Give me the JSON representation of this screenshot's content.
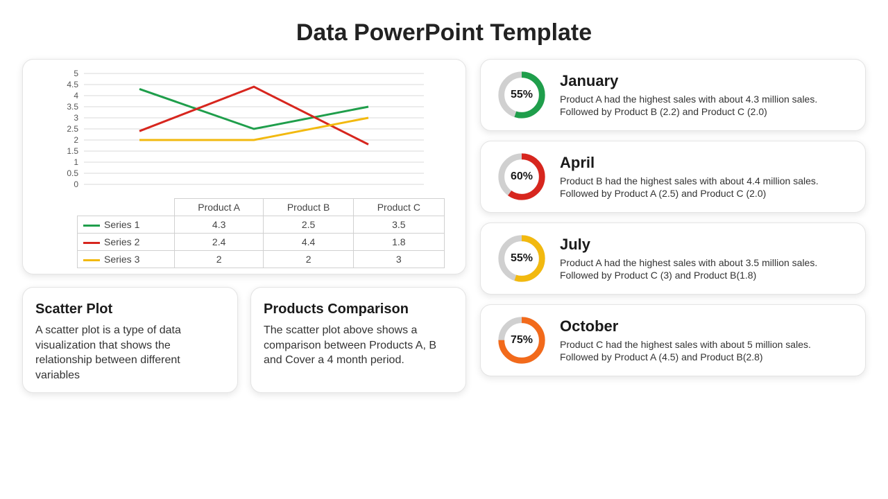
{
  "title": "Data PowerPoint Template",
  "colors": {
    "series1": "#1F9E4B",
    "series2": "#D7261E",
    "series3": "#F2B90F",
    "orange": "#F26A1B"
  },
  "chart_data": {
    "type": "line",
    "categories": [
      "Product A",
      "Product B",
      "Product C"
    ],
    "series": [
      {
        "name": "Series 1",
        "values": [
          4.3,
          2.5,
          3.5
        ],
        "color": "#1F9E4B"
      },
      {
        "name": "Series 2",
        "values": [
          2.4,
          4.4,
          1.8
        ],
        "color": "#D7261E"
      },
      {
        "name": "Series 3",
        "values": [
          2,
          2,
          3
        ],
        "color": "#F2B90F"
      }
    ],
    "ylim": [
      0,
      5
    ],
    "ystep": 0.5,
    "title": "",
    "xlabel": "",
    "ylabel": ""
  },
  "info": {
    "scatter": {
      "title": "Scatter Plot",
      "body": "A scatter plot is a type of data visualization that shows the relationship between different variables"
    },
    "comparison": {
      "title": "Products Comparison",
      "body": "The scatter plot above shows a comparison between Products A, B and Cover a 4 month period."
    }
  },
  "months": [
    {
      "title": "January",
      "pct": 55,
      "pct_label": "55%",
      "color": "#1F9E4B",
      "desc": "Product A had the highest sales with about 4.3 million sales. Followed by Product B (2.2) and Product C (2.0)"
    },
    {
      "title": "April",
      "pct": 60,
      "pct_label": "60%",
      "color": "#D7261E",
      "desc": "Product B had the highest sales with about 4.4 million sales. Followed by Product A (2.5) and Product C (2.0)"
    },
    {
      "title": "July",
      "pct": 55,
      "pct_label": "55%",
      "color": "#F2B90F",
      "desc": "Product A had the highest sales with about 3.5 million sales. Followed by Product C (3) and Product B(1.8)"
    },
    {
      "title": "October",
      "pct": 75,
      "pct_label": "75%",
      "color": "#F26A1B",
      "desc": "Product C had the highest sales with about 5 million sales. Followed by Product A (4.5) and Product B(2.8)"
    }
  ],
  "yticks": [
    "0",
    "0.5",
    "1",
    "1.5",
    "2",
    "2.5",
    "3",
    "3.5",
    "4",
    "4.5",
    "5"
  ]
}
